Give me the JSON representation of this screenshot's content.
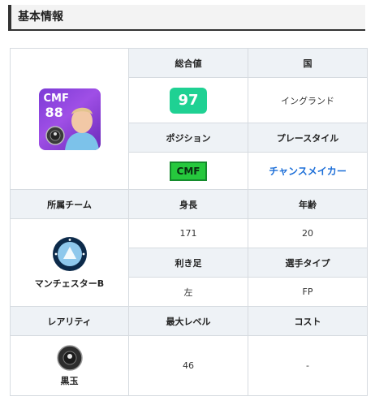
{
  "section_title": "基本情報",
  "card": {
    "position": "CMF",
    "rating": "88"
  },
  "headers": {
    "overall": "総合値",
    "nation": "国",
    "position": "ポジション",
    "playstyle": "プレースタイル",
    "club": "所属チーム",
    "height": "身長",
    "age": "年齢",
    "foot": "利き足",
    "player_type": "選手タイプ",
    "rarity": "レアリティ",
    "max_level": "最大レベル",
    "cost": "コスト"
  },
  "values": {
    "overall": "97",
    "nation": "イングランド",
    "position": "CMF",
    "playstyle": "チャンスメイカー",
    "club": "マンチェスターB",
    "height": "171",
    "age": "20",
    "foot": "左",
    "player_type": "FP",
    "rarity": "黒玉",
    "max_level": "46",
    "cost": "-"
  },
  "colors": {
    "overall_badge": "#1fd193",
    "position_badge": "#26c83d",
    "playstyle_link": "#1d6fd8",
    "card_bg": "#9f4fe6"
  },
  "icons": {
    "club_logo": "club-crest-icon",
    "rarity": "black-ball-icon"
  }
}
